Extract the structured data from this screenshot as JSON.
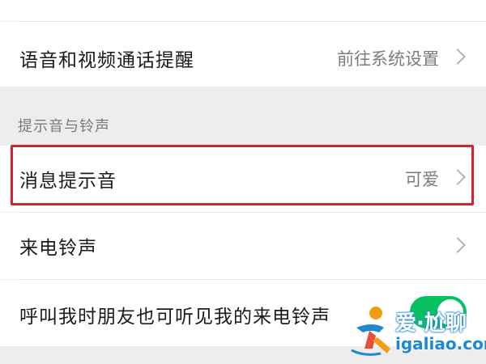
{
  "call_reminder": {
    "label": "语音和视频通话提醒",
    "value": "前往系统设置"
  },
  "section": {
    "header": "提示音与铃声"
  },
  "message_tone": {
    "label": "消息提示音",
    "value": "可爱"
  },
  "ringtone": {
    "label": "来电铃声"
  },
  "friend_hear": {
    "label": "呼叫我时朋友也可听见我的来电铃声",
    "toggle_on": true
  },
  "watermark": {
    "line1": "爱·尬聊",
    "line2": "igaliao.com"
  },
  "colors": {
    "accent_green": "#07c160",
    "highlight_red": "#d8222f",
    "watermark_blue": "#1e88d0"
  }
}
